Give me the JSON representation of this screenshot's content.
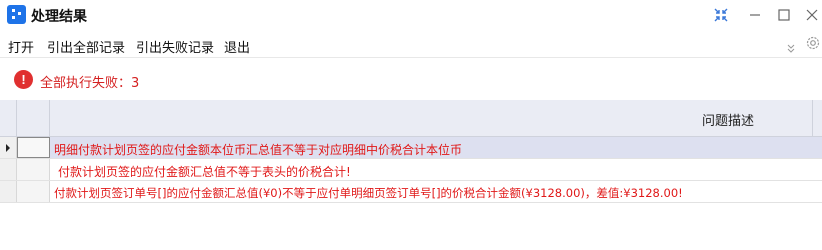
{
  "window": {
    "title": "处理结果"
  },
  "menu": {
    "items": [
      "打开",
      "引出全部记录",
      "引出失败记录",
      "退出"
    ]
  },
  "status": {
    "icon": "error-icon",
    "icon_glyph": "!",
    "text": "全部执行失败：3",
    "color": "#e03030"
  },
  "grid": {
    "header": {
      "description": "问题描述"
    },
    "rows": [
      {
        "message": "明细付款计划页签的应付金额本位币汇总值不等于对应明细中价税合计本位币"
      },
      {
        "message": "付款计划页签的应付金额汇总值不等于表头的价税合计!"
      },
      {
        "message": "付款计划页签订单号[]的应付金额汇总值(¥0)不等于应付单明细页签订单号[]的价税合计金额(¥3128.00)，差值:¥3128.00!"
      }
    ]
  },
  "colors": {
    "accent": "#1e73e8",
    "error_text": "#d42020",
    "selected_row": "#dde0f0"
  }
}
